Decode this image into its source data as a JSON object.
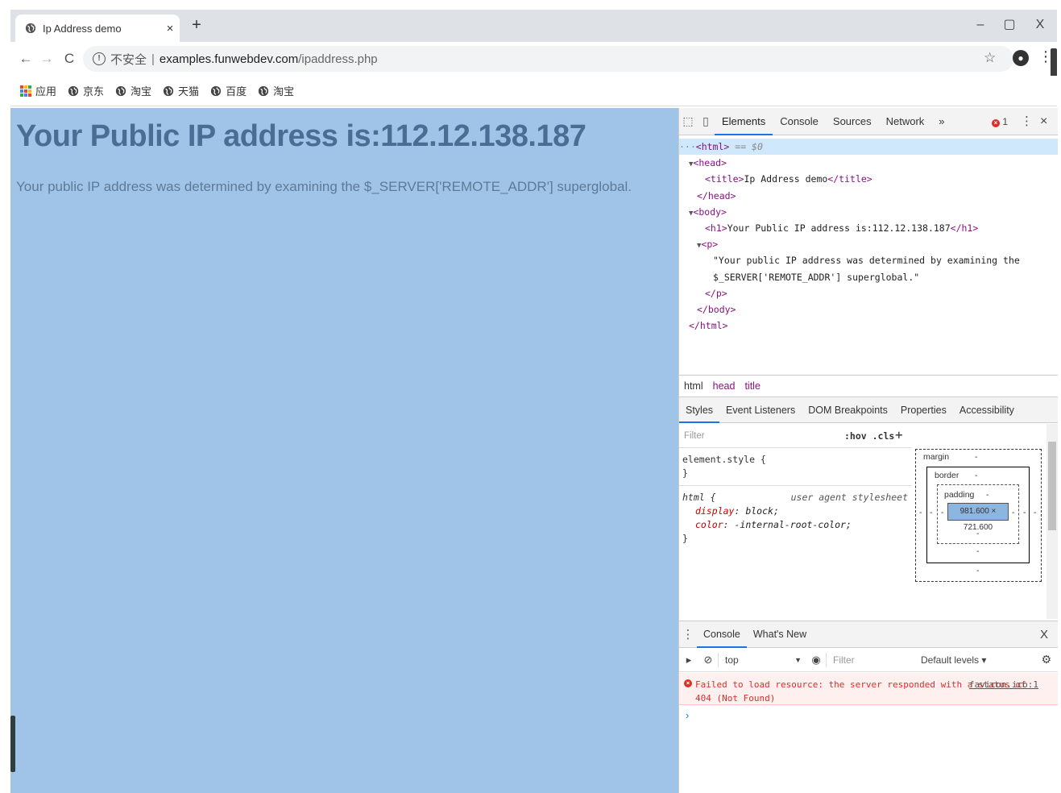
{
  "browser": {
    "tab_title": "Ip Address demo",
    "tab_close": "×",
    "new_tab": "+",
    "window_controls": {
      "minimize": "–",
      "maximize": "▢",
      "close": "X"
    },
    "nav": {
      "back": "←",
      "forward": "→",
      "reload": "C"
    },
    "address": {
      "insecure_label": "不安全",
      "separator": "|",
      "host": "examples.funwebdev.com",
      "path": "/ipaddress.php"
    },
    "bookmarks": [
      {
        "label": "应用",
        "icon": "apps-grid-icon"
      },
      {
        "label": "京东",
        "icon": "globe-icon"
      },
      {
        "label": "淘宝",
        "icon": "globe-icon"
      },
      {
        "label": "天猫",
        "icon": "globe-icon"
      },
      {
        "label": "百度",
        "icon": "globe-icon"
      },
      {
        "label": "淘宝",
        "icon": "globe-icon"
      }
    ]
  },
  "page": {
    "heading": "Your Public IP address is:112.12.138.187",
    "paragraph": "Your public IP address was determined by examining the $_SERVER['REMOTE_ADDR'] superglobal.",
    "background_color": "#a0c4e8"
  },
  "devtools": {
    "tabs": [
      "Elements",
      "Console",
      "Sources",
      "Network"
    ],
    "more": "»",
    "active_tab": "Elements",
    "error_count": "1",
    "dom": {
      "html_open": "<html>",
      "selected_marker": "== $0",
      "head_open": "<head>",
      "title_open": "<title>",
      "title_text": "Ip Address demo",
      "title_close": "</title>",
      "head_close": "</head>",
      "body_open": "<body>",
      "h1_open": "<h1>",
      "h1_text": "Your Public IP address is:112.12.138.187",
      "h1_close": "</h1>",
      "p_open": "<p>",
      "p_text_1": "\"Your public IP address was determined by examining the",
      "p_text_2": "$_SERVER['REMOTE_ADDR'] superglobal.\"",
      "p_close": "</p>",
      "body_close": "</body>",
      "html_close": "</html>"
    },
    "breadcrumb": [
      "html",
      "head",
      "title"
    ],
    "subtabs": [
      "Styles",
      "Event Listeners",
      "DOM Breakpoints",
      "Properties",
      "Accessibility"
    ],
    "styles": {
      "filter_placeholder": "Filter",
      "hov_cls": ":hov .cls",
      "add": "+",
      "element_style": "element.style {",
      "close_brace": "}",
      "html_rule": "html {",
      "origin": "user agent stylesheet",
      "props": [
        {
          "name": "display",
          "value": "block;"
        },
        {
          "name": "color",
          "value": "-internal-root-color;"
        }
      ]
    },
    "box_model": {
      "margin": "margin",
      "border": "border",
      "padding": "padding",
      "content": "981.600 × 721.600",
      "dash": "-"
    },
    "drawer": {
      "tabs": [
        "Console",
        "What's New"
      ],
      "close": "X",
      "context": "top",
      "filter_placeholder": "Filter",
      "levels": "Default levels ▾",
      "error_message_1": "Failed to load resource: the server responded with a status of",
      "error_message_2": "404 (Not Found)",
      "error_source": "favicon.ico:1",
      "prompt": "›"
    }
  }
}
